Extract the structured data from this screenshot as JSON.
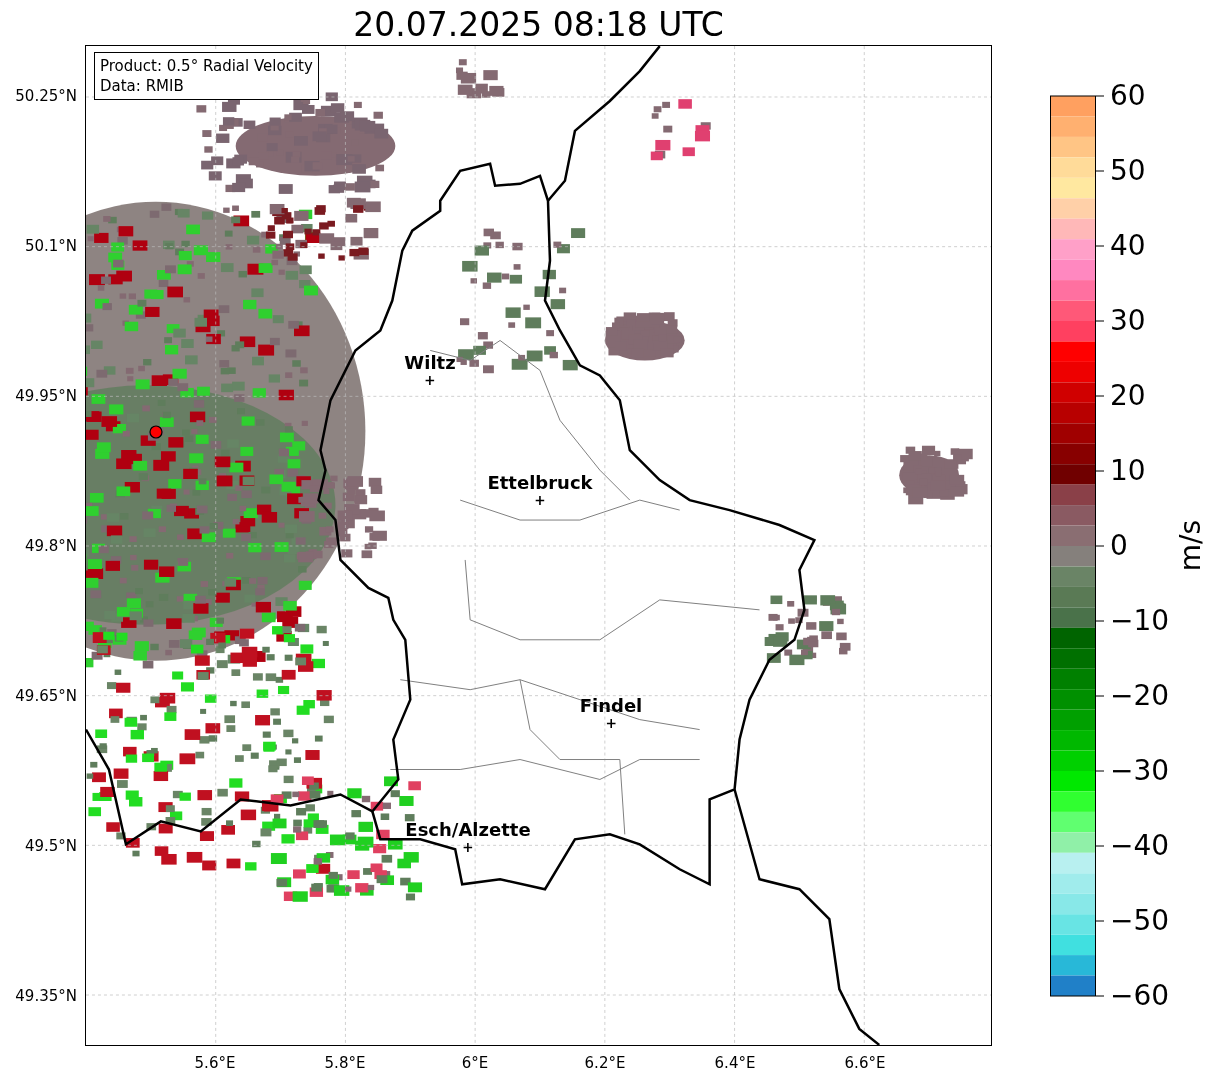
{
  "title": "20.07.2025 08:18 UTC",
  "legend": [
    "Product: 0.5° Radial Velocity",
    "Data: RMIB"
  ],
  "map": {
    "y_ticks": [
      "50.25°N",
      "50.1°N",
      "49.95°N",
      "49.8°N",
      "49.65°N",
      "49.5°N",
      "49.35°N"
    ],
    "x_ticks": [
      "5.6°E",
      "5.8°E",
      "6°E",
      "6.2°E",
      "6.4°E",
      "6.6°E"
    ],
    "cities": [
      {
        "name": "Wiltz"
      },
      {
        "name": "Ettelbruck"
      },
      {
        "name": "Findel"
      },
      {
        "name": "Esch/Alzette"
      }
    ]
  },
  "colorbar": {
    "ticks": [
      "60",
      "50",
      "40",
      "30",
      "20",
      "10",
      "0",
      "−10",
      "−20",
      "−30",
      "−40",
      "−50",
      "−60"
    ],
    "label": "m/s"
  }
}
